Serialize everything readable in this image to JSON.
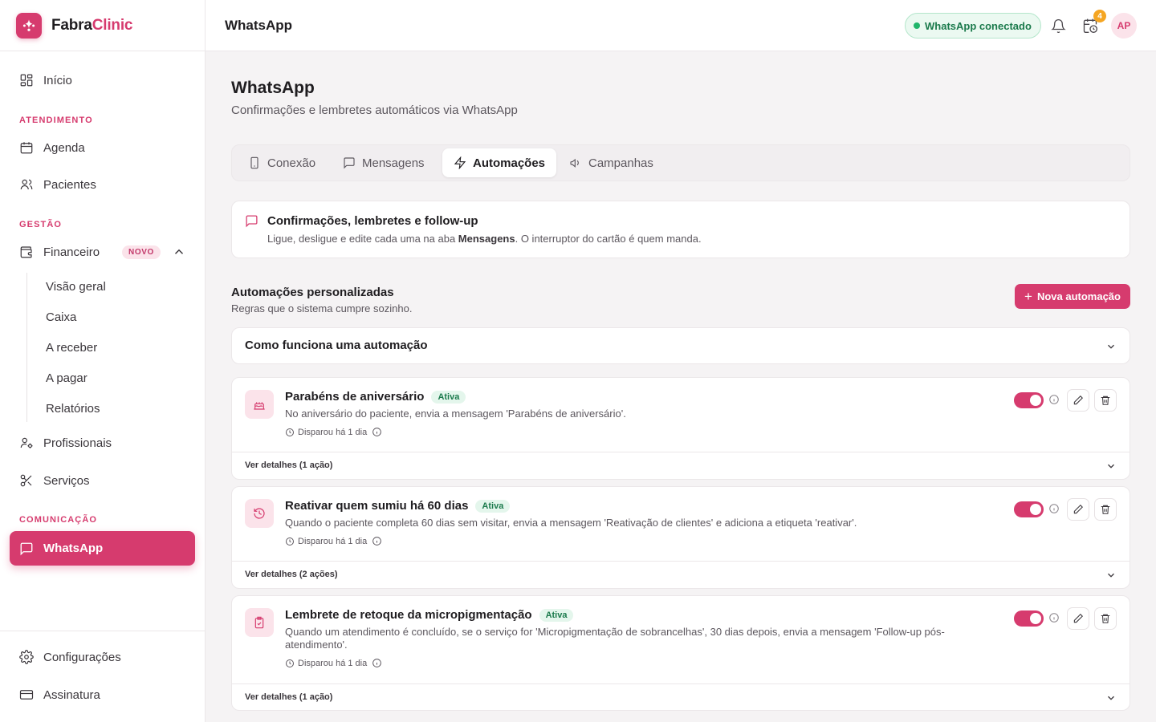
{
  "brand": {
    "name_part1": "Fabra",
    "name_part2": "Clinic"
  },
  "sidebar": {
    "home": "Início",
    "section_atendimento": "ATENDIMENTO",
    "agenda": "Agenda",
    "pacientes": "Pacientes",
    "section_gestao": "GESTÃO",
    "financeiro": "Financeiro",
    "financeiro_badge": "NOVO",
    "sub": [
      "Visão geral",
      "Caixa",
      "A receber",
      "A pagar",
      "Relatórios"
    ],
    "profissionais": "Profissionais",
    "servicos": "Serviços",
    "section_comunicacao": "COMUNICAÇÃO",
    "whatsapp": "WhatsApp",
    "configuracoes": "Configurações",
    "assinatura": "Assinatura"
  },
  "topbar": {
    "title": "WhatsApp",
    "status": "WhatsApp conectado",
    "notif_count": "4",
    "avatar_initials": "AP"
  },
  "page": {
    "title": "WhatsApp",
    "subtitle": "Confirmações e lembretes automáticos via WhatsApp"
  },
  "tabs": [
    "Conexão",
    "Mensagens",
    "Automações",
    "Campanhas"
  ],
  "active_tab": "Automações",
  "info_card": {
    "title": "Confirmações, lembretes e follow-up",
    "text_before": "Ligue, desligue e edite cada uma na aba ",
    "text_bold": "Mensagens",
    "text_after": ". O interruptor do cartão é quem manda."
  },
  "custom": {
    "title": "Automações personalizadas",
    "subtitle": "Regras que o sistema cumpre sozinho.",
    "new_button": "Nova automação",
    "howto": "Como funciona uma automação"
  },
  "automations": [
    {
      "name": "Parabéns de aniversário",
      "status": "Ativa",
      "enabled": true,
      "description": "No aniversário do paciente, envia a mensagem 'Parabéns de aniversário'.",
      "last_run": "Disparou há 1 dia",
      "details": "Ver detalhes (1 ação)",
      "icon": "cake-icon"
    },
    {
      "name": "Reativar quem sumiu há 60 dias",
      "status": "Ativa",
      "enabled": true,
      "description": "Quando o paciente completa 60 dias sem visitar, envia a mensagem 'Reativação de clientes' e adiciona a etiqueta 'reativar'.",
      "last_run": "Disparou há 1 dia",
      "details": "Ver detalhes (2 ações)",
      "icon": "history-icon"
    },
    {
      "name": "Lembrete de retoque da micropigmentação",
      "status": "Ativa",
      "enabled": true,
      "description": "Quando um atendimento é concluído, se o serviço for 'Micropigmentação de sobrancelhas', 30 dias depois, envia a mensagem 'Follow-up pós-atendimento'.",
      "last_run": "Disparou há 1 dia",
      "details": "Ver detalhes (1 ação)",
      "icon": "clipboard-check-icon"
    }
  ],
  "colors": {
    "accent": "#d63b6e",
    "success": "#21b56b",
    "warning": "#f5a623"
  }
}
